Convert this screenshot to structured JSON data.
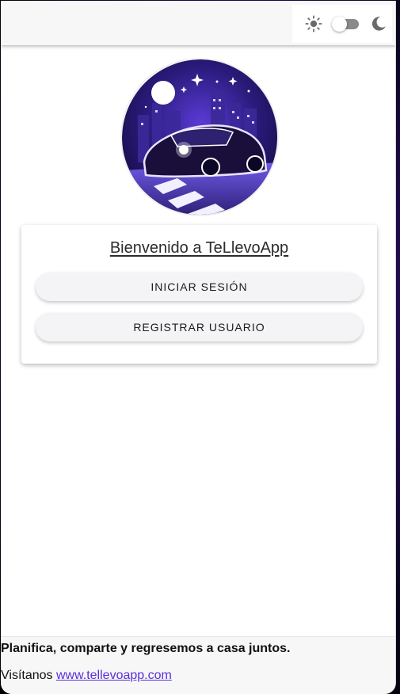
{
  "header": {
    "theme_toggle": {
      "state": "light",
      "left_icon": "sun-icon",
      "right_icon": "moon-icon"
    }
  },
  "logo": {
    "alt": "TeLlevoApp logo"
  },
  "card": {
    "title": "Bienvenido a TeLlevoApp",
    "login_label": "INICIAR SESIÓN",
    "register_label": "REGISTRAR USUARIO"
  },
  "footer": {
    "tagline": "Planifica, comparte y regresemos a casa juntos.",
    "visit_prefix": "Visítanos",
    "link_text": "www.tellevoapp.com"
  },
  "colors": {
    "accent": "#5a2fd8",
    "toolbar_bg": "#f7f7f7",
    "button_bg": "#f4f4f6"
  }
}
